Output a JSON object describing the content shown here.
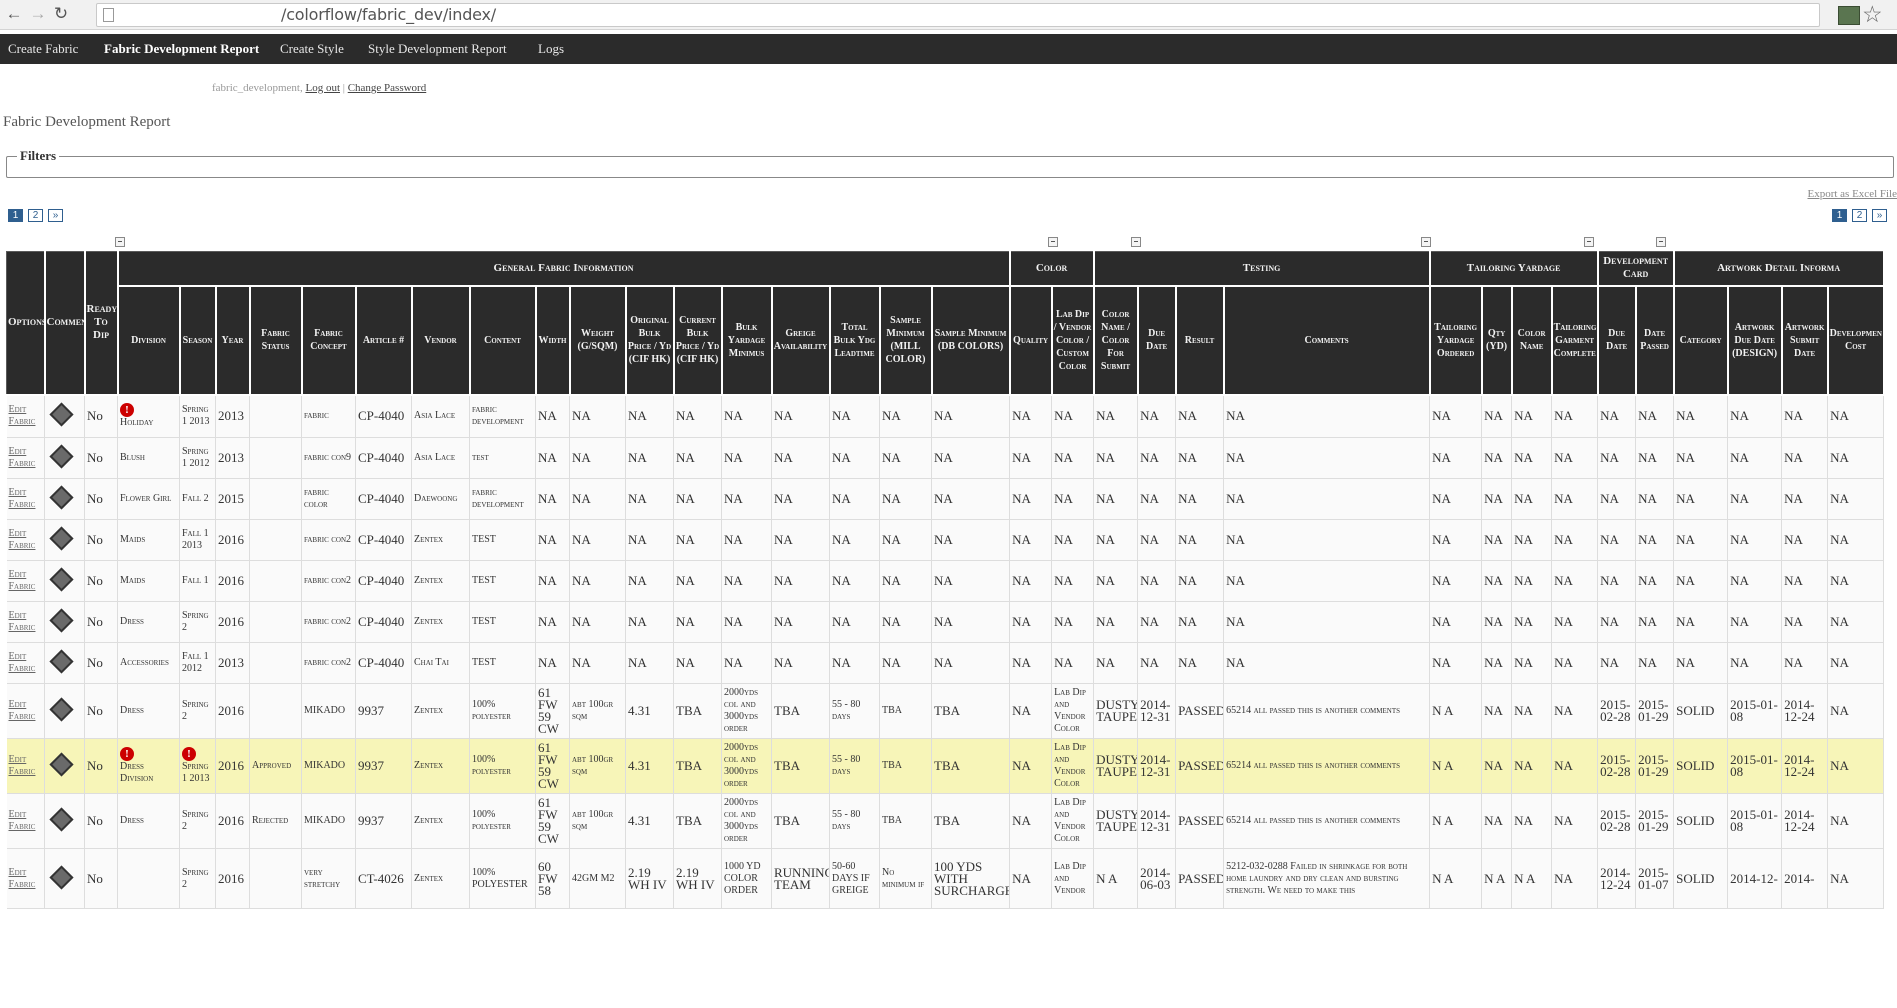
{
  "browser": {
    "url": "/colorflow/fabric_dev/index/"
  },
  "topnav": [
    "Create Fabric",
    "Fabric Development Report",
    "Create Style",
    "Style Development Report",
    "Logs"
  ],
  "user": {
    "name": "fabric_development,",
    "logout": "Log out",
    "sep": "|",
    "change_password": "Change Password"
  },
  "page_title": "Fabric Development Report",
  "filters_label": "Filters",
  "export_label": "Export as Excel File",
  "pager": [
    "1",
    "2",
    "»"
  ],
  "groups": [
    {
      "label": "",
      "span": 3
    },
    {
      "label": "General Fabric Information",
      "span": 17
    },
    {
      "label": "Color",
      "span": 2
    },
    {
      "label": "Testing",
      "span": 4
    },
    {
      "label": "Tailoring Yardage",
      "span": 4
    },
    {
      "label": "Development Card",
      "span": 2
    },
    {
      "label": "Artwork Detail Informa",
      "span": 5
    }
  ],
  "columns": [
    "Options",
    "Comment",
    "Ready To Dip",
    "Division",
    "Season",
    "Year",
    "Fabric Status",
    "Fabric Concept",
    "Article #",
    "Vendor",
    "Content",
    "Width",
    "Weight (G/SQM)",
    "Original Bulk Price / Yd (CIF HK)",
    "Current Bulk Price / Yd (CIF HK)",
    "Bulk Yardage Minimus",
    "Greige Availability",
    "Total Bulk Ydg Leadtime",
    "Sample Minimum (MILL COLOR)",
    "Sample Minimum (DB COLORS)",
    "Quality",
    "Lab Dip / Vendor Color / Custom Color",
    "Color Name / Color For Submit",
    "Due Date",
    "Result",
    "Comments",
    "Tailoring Yardage Ordered",
    "Qty (YD)",
    "Color Name",
    "Tailoring Garment Complete",
    "Due Date",
    "Date Passed",
    "Category",
    "Artwork Due Date (DESIGN)",
    "Artwork Submit Date",
    "Developmen Cost"
  ],
  "rows": [
    {
      "edit": "Edit Fabric",
      "ready": "No",
      "div_info": true,
      "division": "Holiday",
      "season": "Spring 1 2013",
      "season_info": false,
      "year": "2013",
      "status": "",
      "concept": "fabric",
      "article": "CP-4040",
      "vendor": "Asia Lace",
      "content": "fabric development",
      "width": "NA",
      "weight": "NA",
      "orig": "NA",
      "cur": "NA",
      "bulkmin": "NA",
      "greige": "NA",
      "lead": "NA",
      "smill": "NA",
      "sdb": "NA",
      "quality": "NA",
      "labdip": "NA",
      "colorname": "NA",
      "due": "NA",
      "result": "NA",
      "comments": "NA",
      "tyo": "NA",
      "qty": "NA",
      "tcolor": "NA",
      "tgc": "NA",
      "ddue": "NA",
      "dpass": "NA",
      "cat": "NA",
      "aw_due": "NA",
      "aw_sub": "NA",
      "devcost": "NA",
      "hl": false
    },
    {
      "edit": "Edit Fabric",
      "ready": "No",
      "div_info": false,
      "division": "Blush",
      "season": "Spring 1 2012",
      "season_info": false,
      "year": "2013",
      "status": "",
      "concept": "fabric con9",
      "article": "CP-4040",
      "vendor": "Asia Lace",
      "content": "test",
      "width": "NA",
      "weight": "NA",
      "orig": "NA",
      "cur": "NA",
      "bulkmin": "NA",
      "greige": "NA",
      "lead": "NA",
      "smill": "NA",
      "sdb": "NA",
      "quality": "NA",
      "labdip": "NA",
      "colorname": "NA",
      "due": "NA",
      "result": "NA",
      "comments": "NA",
      "tyo": "NA",
      "qty": "NA",
      "tcolor": "NA",
      "tgc": "NA",
      "ddue": "NA",
      "dpass": "NA",
      "cat": "NA",
      "aw_due": "NA",
      "aw_sub": "NA",
      "devcost": "NA",
      "hl": false
    },
    {
      "edit": "Edit Fabric",
      "ready": "No",
      "div_info": false,
      "division": "Flower Girl",
      "season": "Fall 2",
      "season_info": false,
      "year": "2015",
      "status": "",
      "concept": "fabric color",
      "article": "CP-4040",
      "vendor": "Daewoong",
      "content": "fabric development",
      "width": "NA",
      "weight": "NA",
      "orig": "NA",
      "cur": "NA",
      "bulkmin": "NA",
      "greige": "NA",
      "lead": "NA",
      "smill": "NA",
      "sdb": "NA",
      "quality": "NA",
      "labdip": "NA",
      "colorname": "NA",
      "due": "NA",
      "result": "NA",
      "comments": "NA",
      "tyo": "NA",
      "qty": "NA",
      "tcolor": "NA",
      "tgc": "NA",
      "ddue": "NA",
      "dpass": "NA",
      "cat": "NA",
      "aw_due": "NA",
      "aw_sub": "NA",
      "devcost": "NA",
      "hl": false
    },
    {
      "edit": "Edit Fabric",
      "ready": "No",
      "div_info": false,
      "division": "Maids",
      "season": "Fall 1 2013",
      "season_info": false,
      "year": "2016",
      "status": "",
      "concept": "fabric con2",
      "article": "CP-4040",
      "vendor": "Zentex",
      "content": "TEST",
      "width": "NA",
      "weight": "NA",
      "orig": "NA",
      "cur": "NA",
      "bulkmin": "NA",
      "greige": "NA",
      "lead": "NA",
      "smill": "NA",
      "sdb": "NA",
      "quality": "NA",
      "labdip": "NA",
      "colorname": "NA",
      "due": "NA",
      "result": "NA",
      "comments": "NA",
      "tyo": "NA",
      "qty": "NA",
      "tcolor": "NA",
      "tgc": "NA",
      "ddue": "NA",
      "dpass": "NA",
      "cat": "NA",
      "aw_due": "NA",
      "aw_sub": "NA",
      "devcost": "NA",
      "hl": false
    },
    {
      "edit": "Edit Fabric",
      "ready": "No",
      "div_info": false,
      "division": "Maids",
      "season": "Fall 1",
      "season_info": false,
      "year": "2016",
      "status": "",
      "concept": "fabric con2",
      "article": "CP-4040",
      "vendor": "Zentex",
      "content": "TEST",
      "width": "NA",
      "weight": "NA",
      "orig": "NA",
      "cur": "NA",
      "bulkmin": "NA",
      "greige": "NA",
      "lead": "NA",
      "smill": "NA",
      "sdb": "NA",
      "quality": "NA",
      "labdip": "NA",
      "colorname": "NA",
      "due": "NA",
      "result": "NA",
      "comments": "NA",
      "tyo": "NA",
      "qty": "NA",
      "tcolor": "NA",
      "tgc": "NA",
      "ddue": "NA",
      "dpass": "NA",
      "cat": "NA",
      "aw_due": "NA",
      "aw_sub": "NA",
      "devcost": "NA",
      "hl": false
    },
    {
      "edit": "Edit Fabric",
      "ready": "No",
      "div_info": false,
      "division": "Dress",
      "season": "Spring 2",
      "season_info": false,
      "year": "2016",
      "status": "",
      "concept": "fabric con2",
      "article": "CP-4040",
      "vendor": "Zentex",
      "content": "TEST",
      "width": "NA",
      "weight": "NA",
      "orig": "NA",
      "cur": "NA",
      "bulkmin": "NA",
      "greige": "NA",
      "lead": "NA",
      "smill": "NA",
      "sdb": "NA",
      "quality": "NA",
      "labdip": "NA",
      "colorname": "NA",
      "due": "NA",
      "result": "NA",
      "comments": "NA",
      "tyo": "NA",
      "qty": "NA",
      "tcolor": "NA",
      "tgc": "NA",
      "ddue": "NA",
      "dpass": "NA",
      "cat": "NA",
      "aw_due": "NA",
      "aw_sub": "NA",
      "devcost": "NA",
      "hl": false
    },
    {
      "edit": "Edit Fabric",
      "ready": "No",
      "div_info": false,
      "division": "Accessories",
      "season": "Fall 1 2012",
      "season_info": false,
      "year": "2013",
      "status": "",
      "concept": "fabric con2",
      "article": "CP-4040",
      "vendor": "Chai Tai",
      "content": "TEST",
      "width": "NA",
      "weight": "NA",
      "orig": "NA",
      "cur": "NA",
      "bulkmin": "NA",
      "greige": "NA",
      "lead": "NA",
      "smill": "NA",
      "sdb": "NA",
      "quality": "NA",
      "labdip": "NA",
      "colorname": "NA",
      "due": "NA",
      "result": "NA",
      "comments": "NA",
      "tyo": "NA",
      "qty": "NA",
      "tcolor": "NA",
      "tgc": "NA",
      "ddue": "NA",
      "dpass": "NA",
      "cat": "NA",
      "aw_due": "NA",
      "aw_sub": "NA",
      "devcost": "NA",
      "hl": false
    },
    {
      "edit": "Edit Fabric",
      "ready": "No",
      "div_info": false,
      "division": "Dress",
      "season": "Spring 2",
      "season_info": false,
      "year": "2016",
      "status": "",
      "concept": "MIKADO",
      "article": "9937",
      "vendor": "Zentex",
      "content": "100% polyester",
      "width": "61 FW 59 CW",
      "weight": "abt 100gr sqm",
      "orig": "4.31",
      "cur": "TBA",
      "bulkmin": "2000yds col and 3000yds order",
      "greige": "TBA",
      "lead": "55 - 80 days",
      "smill": "TBA",
      "sdb": "TBA",
      "quality": "NA",
      "labdip": "Lab Dip and Vendor Color",
      "colorname": "DUSTY TAUPE",
      "due": "2014-12-31",
      "result": "PASSED",
      "comments": "65214 all passed this is another comments",
      "tyo": "N A",
      "qty": "NA",
      "tcolor": "NA",
      "tgc": "NA",
      "ddue": "2015-02-28",
      "dpass": "2015-01-29",
      "cat": "SOLID",
      "aw_due": "2015-01-08",
      "aw_sub": "2014-12-24",
      "devcost": "NA",
      "hl": false
    },
    {
      "edit": "Edit Fabric",
      "ready": "No",
      "div_info": true,
      "division": "Dress Division",
      "season": "Spring 1 2013",
      "season_info": true,
      "year": "2016",
      "status": "Approved",
      "concept": "MIKADO",
      "article": "9937",
      "vendor": "Zentex",
      "content": "100% polyester",
      "width": "61 FW 59 CW",
      "weight": "abt 100gr sqm",
      "orig": "4.31",
      "cur": "TBA",
      "bulkmin": "2000yds col and 3000yds order",
      "greige": "TBA",
      "lead": "55 - 80 days",
      "smill": "TBA",
      "sdb": "TBA",
      "quality": "NA",
      "labdip": "Lab Dip and Vendor Color",
      "colorname": "DUSTY TAUPE",
      "due": "2014-12-31",
      "result": "PASSED",
      "comments": "65214 all passed this is another comments",
      "tyo": "N A",
      "qty": "NA",
      "tcolor": "NA",
      "tgc": "NA",
      "ddue": "2015-02-28",
      "dpass": "2015-01-29",
      "cat": "SOLID",
      "aw_due": "2015-01-08",
      "aw_sub": "2014-12-24",
      "devcost": "NA",
      "hl": true
    },
    {
      "edit": "Edit Fabric",
      "ready": "No",
      "div_info": false,
      "division": "Dress",
      "season": "Spring 2",
      "season_info": false,
      "year": "2016",
      "status": "Rejected",
      "concept": "MIKADO",
      "article": "9937",
      "vendor": "Zentex",
      "content": "100% polyester",
      "width": "61 FW 59 CW",
      "weight": "abt 100gr sqm",
      "orig": "4.31",
      "cur": "TBA",
      "bulkmin": "2000yds col and 3000yds order",
      "greige": "TBA",
      "lead": "55 - 80 days",
      "smill": "TBA",
      "sdb": "TBA",
      "quality": "NA",
      "labdip": "Lab Dip and Vendor Color",
      "colorname": "DUSTY TAUPE",
      "due": "2014-12-31",
      "result": "PASSED",
      "comments": "65214 all passed this is another comments",
      "tyo": "N A",
      "qty": "NA",
      "tcolor": "NA",
      "tgc": "NA",
      "ddue": "2015-02-28",
      "dpass": "2015-01-29",
      "cat": "SOLID",
      "aw_due": "2015-01-08",
      "aw_sub": "2014-12-24",
      "devcost": "NA",
      "hl": false
    },
    {
      "edit": "Edit Fabric",
      "ready": "No",
      "div_info": false,
      "division": "",
      "season": "Spring 2",
      "season_info": false,
      "year": "2016",
      "status": "",
      "concept": "very stretchy",
      "article": "CT-4026",
      "vendor": "Zentex",
      "content": "100% POLYESTER",
      "width": "60 FW 58",
      "weight": "42GM M2",
      "orig": "2.19 WH IV",
      "cur": "2.19 WH IV",
      "bulkmin": "1000 YD COLOR ORDER",
      "greige": "RUNNING TEAM",
      "lead": "50-60 DAYS IF GREIGE",
      "smill": "No minimum if",
      "sdb": "100 YDS WITH SURCHARGE",
      "quality": "NA",
      "labdip": "Lab Dip and Vendor",
      "colorname": "N A",
      "due": "2014-06-03",
      "result": "PASSED",
      "comments": "5212-032-0288 Failed in shrinkage for both home laundry and dry clean and bursting strength. We need to make this",
      "tyo": "N A",
      "qty": "N A",
      "tcolor": "N A",
      "tgc": "NA",
      "ddue": "2014-12-24",
      "dpass": "2015-01-07",
      "cat": "SOLID",
      "aw_due": "2014-12-",
      "aw_sub": "2014-",
      "devcost": "NA",
      "hl": false
    }
  ]
}
